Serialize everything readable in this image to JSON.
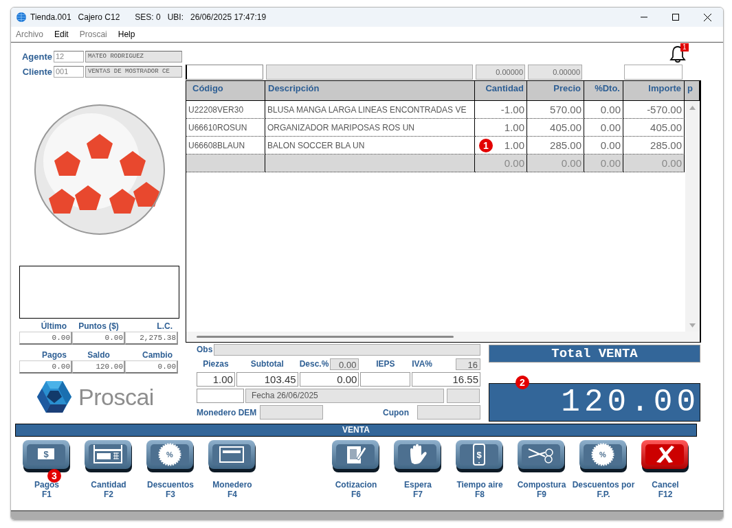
{
  "window": {
    "title_parts": [
      "Tienda.001",
      "Cajero C12",
      "SES: 0",
      "UBI:",
      "26/06/2025 17:47:19"
    ]
  },
  "menu": [
    {
      "label": "Archivo",
      "disabled": true
    },
    {
      "label": "Edit",
      "disabled": false
    },
    {
      "label": "Proscai",
      "disabled": true
    },
    {
      "label": "Help",
      "disabled": false
    }
  ],
  "notifications": {
    "count": "1"
  },
  "agent": {
    "label": "Agente",
    "code": "12",
    "name": "MATEO RODRIGUEZ"
  },
  "client": {
    "label": "Cliente",
    "code": "001",
    "name": "VENTAS DE MOSTRADOR CE"
  },
  "entry": {
    "value_1": "0.00000",
    "value_2": "0.00000"
  },
  "table": {
    "columns": [
      "Código",
      "Descripción",
      "Cantidad",
      "Precio",
      "%Dto.",
      "Importe",
      "p"
    ],
    "rows": [
      {
        "kind": "item",
        "cells": [
          "U22208VER30",
          "BLUSA MANGA LARGA LINEAS ENCONTRADAS VE",
          "-1.00",
          "570.00",
          "0.00",
          "-570.00"
        ]
      },
      {
        "kind": "item",
        "cells": [
          "U66610ROSUN",
          "ORGANIZADOR MARIPOSAS ROS UN",
          "1.00",
          "405.00",
          "0.00",
          "405.00"
        ]
      },
      {
        "kind": "item",
        "cells": [
          "U66608BLAUN",
          "BALON SOCCER BLA UN",
          "1.00",
          "285.00",
          "0.00",
          "285.00"
        ],
        "callout": "1"
      },
      {
        "kind": "pending",
        "cells": [
          "",
          "",
          "0.00",
          "0.00",
          "0.00",
          "0.00"
        ]
      }
    ]
  },
  "stats": [
    {
      "label": "Último",
      "value": "0.00"
    },
    {
      "label": "Puntos ($)",
      "value": "0.00"
    },
    {
      "label": "L.C.",
      "value": "2,275.38"
    },
    {
      "label": "Pagos",
      "value": "0.00"
    },
    {
      "label": "Saldo",
      "value": "120.00"
    },
    {
      "label": "Cambio",
      "value": "0.00"
    }
  ],
  "logo": {
    "text": "Proscai"
  },
  "summary": {
    "obs_label": "Obs",
    "columns": [
      {
        "label": "Piezas",
        "value": "1.00"
      },
      {
        "label": "Subtotal",
        "value": "103.45"
      },
      {
        "label": "Desc.%",
        "preset": "0.00",
        "value": "0.00"
      },
      {
        "label": "IEPS"
      },
      {
        "label": "IVA%",
        "preset": "16",
        "value": "16.55"
      }
    ],
    "date": "Fecha 26/06/2025",
    "wallet_label": "Monedero DEM",
    "coupon_label": "Cupon"
  },
  "total": {
    "title": "Total VENTA",
    "amount": "120.00",
    "callout": "2"
  },
  "section_bar": "VENTA",
  "actions": [
    {
      "kind": "cash",
      "label": "Pagos",
      "key": "F1",
      "callout": "3",
      "glyph": "$"
    },
    {
      "kind": "register",
      "label": "Cantidad",
      "key": "F2"
    },
    {
      "kind": "discount",
      "label": "Descuentos",
      "key": "F3",
      "glyph": "%"
    },
    {
      "kind": "card",
      "label": "Monedero",
      "key": "F4"
    },
    {
      "kind": "document",
      "label": "Cotizacion",
      "key": "F6"
    },
    {
      "kind": "hand",
      "label": "Espera",
      "key": "F7"
    },
    {
      "kind": "phone",
      "label": "Tiempo aire",
      "key": "F8",
      "glyph": "$"
    },
    {
      "kind": "scissors",
      "label": "Compostura",
      "key": "F9"
    },
    {
      "kind": "discount",
      "label": "Descuentos por",
      "key": "F.P.",
      "glyph": "%"
    },
    {
      "kind": "cancel",
      "label": "Cancel",
      "key": "F12"
    }
  ]
}
